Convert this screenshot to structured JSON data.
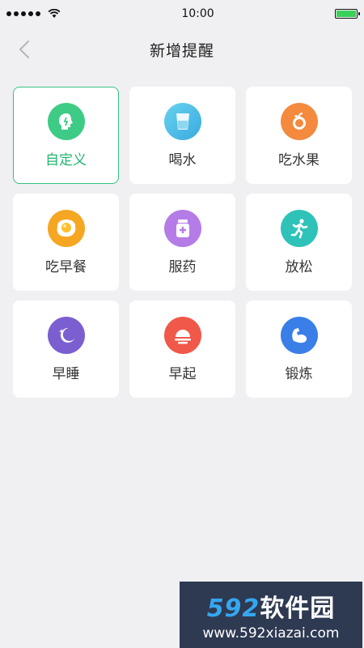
{
  "status": {
    "time": "10:00"
  },
  "header": {
    "title": "新增提醒"
  },
  "reminders": [
    {
      "label": "自定义",
      "icon": "custom-icon",
      "color": "#3ecb85",
      "selected": true
    },
    {
      "label": "喝水",
      "icon": "water-glass-icon",
      "color": "#42b9e6"
    },
    {
      "label": "吃水果",
      "icon": "fruit-icon",
      "color": "#f38a3e"
    },
    {
      "label": "吃早餐",
      "icon": "fried-egg-icon",
      "color": "#f5a623"
    },
    {
      "label": "服药",
      "icon": "medicine-bottle-icon",
      "color": "#b57ce8"
    },
    {
      "label": "放松",
      "icon": "running-person-icon",
      "color": "#2fc2b8"
    },
    {
      "label": "早睡",
      "icon": "moon-stars-icon",
      "color": "#7b5fd0"
    },
    {
      "label": "早起",
      "icon": "sunrise-icon",
      "color": "#f0584a"
    },
    {
      "label": "锻炼",
      "icon": "muscle-arm-icon",
      "color": "#3a7ee8"
    }
  ],
  "watermark": {
    "brand_num": "592",
    "brand_text": "软件园",
    "url": "www.592xiazai.com"
  }
}
